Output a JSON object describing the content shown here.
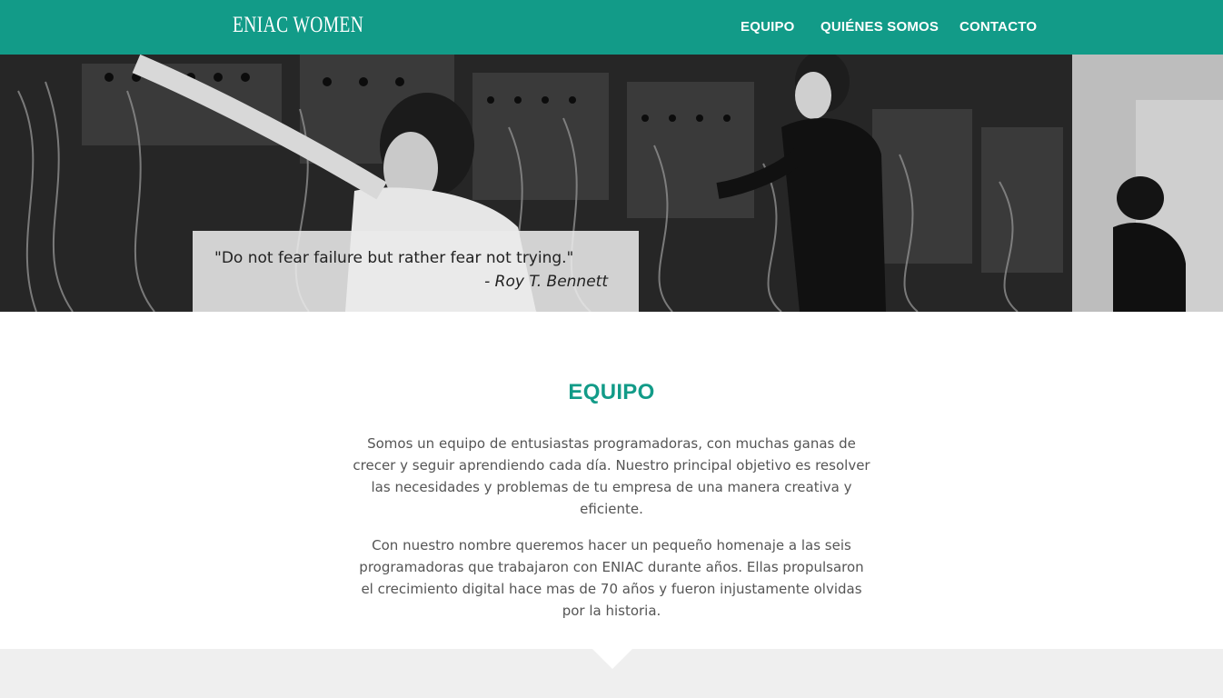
{
  "header": {
    "brand": "ENIAC WOMEN",
    "nav": [
      "EQUIPO",
      "QUIÉNES SOMOS",
      "CONTACTO"
    ]
  },
  "hero": {
    "quote": "\"Do not fear failure but rather fear not trying.\"",
    "author": "- Roy T. Bennett"
  },
  "main": {
    "title": "EQUIPO",
    "paragraphs": [
      "Somos un equipo de entusiastas programadoras, con muchas ganas de crecer y seguir aprendiendo cada día. Nuestro principal objetivo es resolver las necesidades y problemas de tu empresa de una manera creativa y eficiente.",
      "Con nuestro nombre queremos hacer un pequeño homenaje a las seis programadoras que trabajaron con ENIAC durante años. Ellas propulsaron el crecimiento digital hace mas de 70 años y fueron injustamente olvidas por la historia."
    ]
  },
  "colors": {
    "accent": "#129b88",
    "band": "#efefef"
  }
}
